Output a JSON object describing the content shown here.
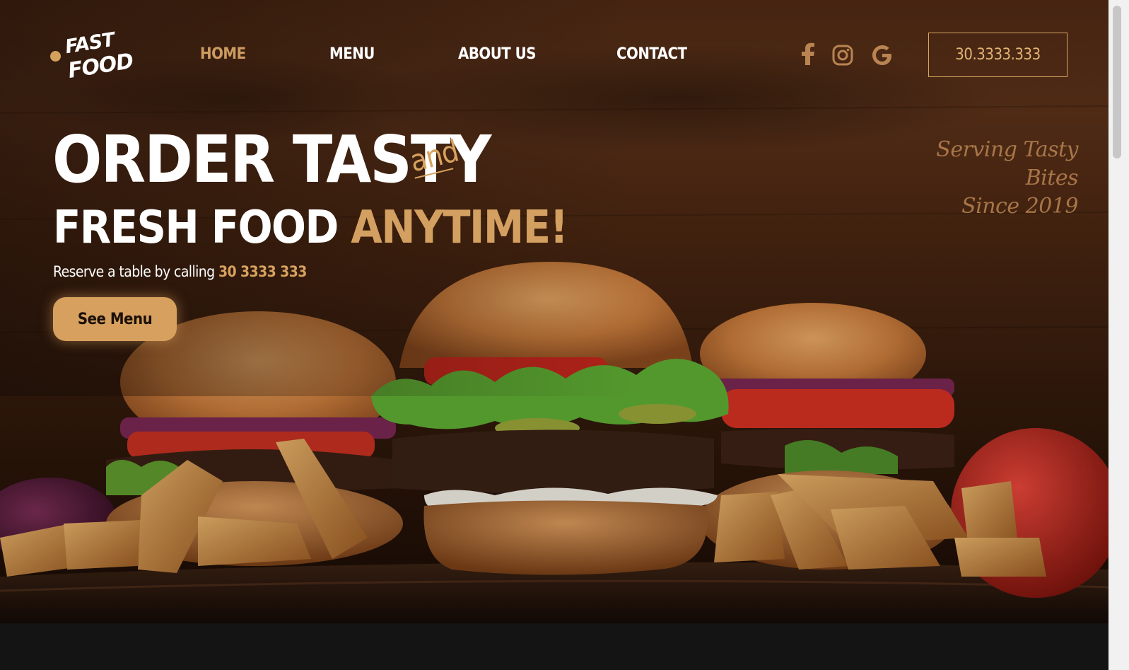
{
  "logo": {
    "line1": "FAST",
    "line2": "FOOD"
  },
  "nav": {
    "items": [
      {
        "label": "HOME",
        "active": true
      },
      {
        "label": "MENU",
        "active": false
      },
      {
        "label": "ABOUT US",
        "active": false
      },
      {
        "label": "CONTACT",
        "active": false
      }
    ]
  },
  "social": {
    "icons": [
      "facebook-icon",
      "instagram-icon",
      "google-icon"
    ]
  },
  "header": {
    "phone": "30.3333.333"
  },
  "hero": {
    "headline_line1": "ORDER TASTY",
    "headline_and": "and",
    "headline_line2_white": "FRESH FOOD",
    "headline_line2_accent": "ANYTIME!",
    "reserve_text": "Reserve a table by calling",
    "reserve_number": "30 3333 333",
    "cta_label": "See Menu",
    "tagline_line1": "Serving Tasty Bites",
    "tagline_line2": "Since 2019"
  },
  "colors": {
    "accent": "#d7a05f",
    "nav_active": "#cd9b62",
    "text": "#ffffff",
    "background_dark": "#141414"
  }
}
